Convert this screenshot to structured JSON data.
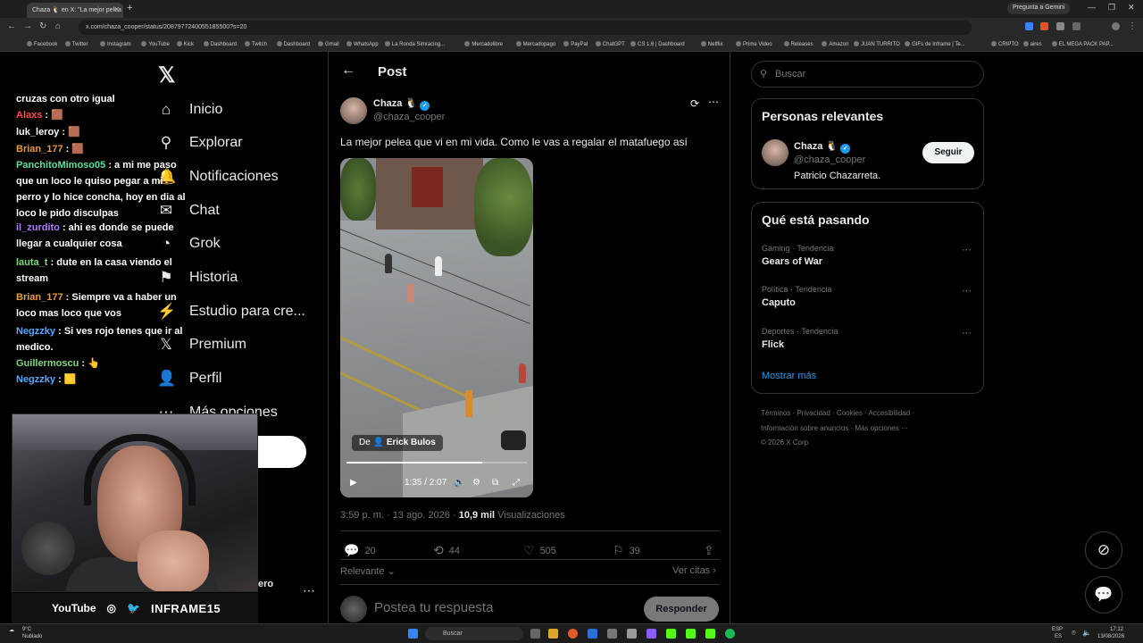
{
  "browser": {
    "tab_title": "Chaza 🐧 en X: \"La mejor pelea",
    "ask_gemini": "Pregunta a Gemini",
    "url": "x.com/chaza_cooper/status/2087977240055185500?s=20",
    "bookmarks": [
      "Facebook",
      "Twitter",
      "Instagram",
      "YouTube",
      "Kick",
      "Dashboard",
      "Twitch",
      "Dashboard",
      "Gmail",
      "WhatsApp",
      "La Ronda Simracing...",
      "Mercadolibre",
      "Mercadopago",
      "PayPal",
      "ChatGPT",
      "CS 1.6 | Dashboard",
      "Netflix",
      "Prime Video",
      "Releases",
      "Amazon",
      "JUAN TURRITO",
      "GIFs de Inframe | Te...",
      "CRIPTO",
      "aires",
      "EL MEGA PACK PAP..."
    ]
  },
  "nav": {
    "items": [
      {
        "label": "Inicio",
        "icon": "home-icon"
      },
      {
        "label": "Explorar",
        "icon": "search-icon"
      },
      {
        "label": "Notificaciones",
        "icon": "bell-icon"
      },
      {
        "label": "Chat",
        "icon": "chat-icon"
      },
      {
        "label": "Grok",
        "icon": "grok-icon"
      },
      {
        "label": "Historia",
        "icon": "bookmark-icon"
      },
      {
        "label": "Estudio para cre...",
        "icon": "studio-icon"
      },
      {
        "label": "Premium",
        "icon": "premium-icon"
      },
      {
        "label": "Perfil",
        "icon": "profile-icon"
      },
      {
        "label": "Más opciones",
        "icon": "more-icon"
      }
    ],
    "profile_cut": "ero"
  },
  "stream_chat": [
    {
      "user": "",
      "msg": "cruzas con otro igual"
    },
    {
      "user": "Alaxs",
      "msg": ": 🟫",
      "color": "#ff4d4d"
    },
    {
      "user": "luk_leroy",
      "msg": ": 🟫",
      "color": "#ffffff"
    },
    {
      "user": "Brian_177",
      "msg": ": 🟫",
      "color": "#e89a3c"
    },
    {
      "user": "PanchitoMimoso05",
      "msg": ": a mi me paso que un loco le quiso pegar a mi perro y lo hice concha, hoy en dia al loco le pido disculpas",
      "color": "#5ce0a0"
    },
    {
      "user": "il_zurdito",
      "msg": ": ahi es donde se puede llegar a cualquier cosa",
      "color": "#b07cff"
    },
    {
      "user": "lauta_t",
      "msg": ": dute en la casa viendo el stream",
      "color": "#7cd97c"
    },
    {
      "user": "Brian_177",
      "msg": ": Siempre va a haber un loco mas loco que vos",
      "color": "#e89a3c"
    },
    {
      "user": "Negzzky",
      "msg": ": Si ves rojo tenes que ir al medico.",
      "color": "#5aa9ff"
    },
    {
      "user": "Guillermoscu",
      "msg": ": 👆",
      "color": "#7cd97c"
    },
    {
      "user": "Negzzky",
      "msg": ": 🟨",
      "color": "#5aa9ff"
    }
  ],
  "stream_banner": {
    "yt": "YouTube",
    "brand": "INFRAME15"
  },
  "post": {
    "header": "Post",
    "author_name": "Chaza 🐧",
    "author_handle": "@chaza_cooper",
    "text": "La mejor pelea que vi en mi vida. Como le vas a regalar el matafuego así",
    "video_credit_prefix": "De",
    "video_credit_name": "Erick Bulos",
    "video_time": "1:35 / 2:07",
    "video_progress": 0.75,
    "time": "3:59 p. m. · 13 ago. 2026 ·",
    "views_count": "10,9 mil",
    "views_label": "Visualizaciones",
    "replies": "20",
    "reposts": "44",
    "likes": "505",
    "bookmarks": "39",
    "sort": "Relevante",
    "quotes": "Ver citas",
    "reply_placeholder": "Postea tu respuesta",
    "reply_button": "Responder"
  },
  "sidebar": {
    "search_placeholder": "Buscar",
    "relevant_title": "Personas relevantes",
    "relevant_name": "Chaza 🐧",
    "relevant_handle": "@chaza_cooper",
    "relevant_bio": "Patricio Chazarreta.",
    "follow": "Seguir",
    "trends_title": "Qué está pasando",
    "trends": [
      {
        "category": "Gaming · Tendencia",
        "name": "Gears of War"
      },
      {
        "category": "Política · Tendencia",
        "name": "Caputo"
      },
      {
        "category": "Deportes · Tendencia",
        "name": "Flick"
      }
    ],
    "show_more": "Mostrar más",
    "footer_line1": "Términos · Privacidad · Cookies · Accesibilidad ·",
    "footer_line2": "Información sobre anuncios · Más opciones ···",
    "footer_line3": "© 2026 X Corp."
  },
  "taskbar": {
    "weather_temp": "9°C",
    "weather_desc": "Nublado",
    "search": "Buscar",
    "lang1": "ESP",
    "lang2": "ES",
    "time": "17:12",
    "date": "13/08/2026"
  },
  "colors": {
    "accent": "#1d9bf0",
    "bg": "#000000",
    "border": "#2f3336",
    "muted": "#71767b"
  }
}
